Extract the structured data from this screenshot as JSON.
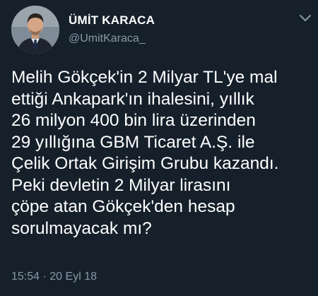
{
  "tweet": {
    "display_name": "ÜMİT KARACA",
    "handle": "@UmitKaraca_",
    "text_lines": [
      "Melih Gökçek'in 2 Milyar TL'ye mal",
      "ettiği Ankapark'ın ihalesini, yıllık",
      "26 milyon 400 bin lira üzerinden",
      "29 yıllığına GBM Ticaret A.Ş. ile",
      "Çelik Ortak Girişim Grubu kazandı.",
      "Peki devletin 2 Milyar lirasını",
      "çöpe atan Gökçek'den hesap",
      "sorulmayacak mı?"
    ],
    "time": "15:54",
    "separator": "·",
    "date": "20 Eyl 18"
  },
  "colors": {
    "background": "#15202b",
    "primary_text": "#ffffff",
    "secondary_text": "#8899a6"
  },
  "icons": {
    "menu": "chevron-down-icon",
    "avatar": "profile-photo"
  }
}
